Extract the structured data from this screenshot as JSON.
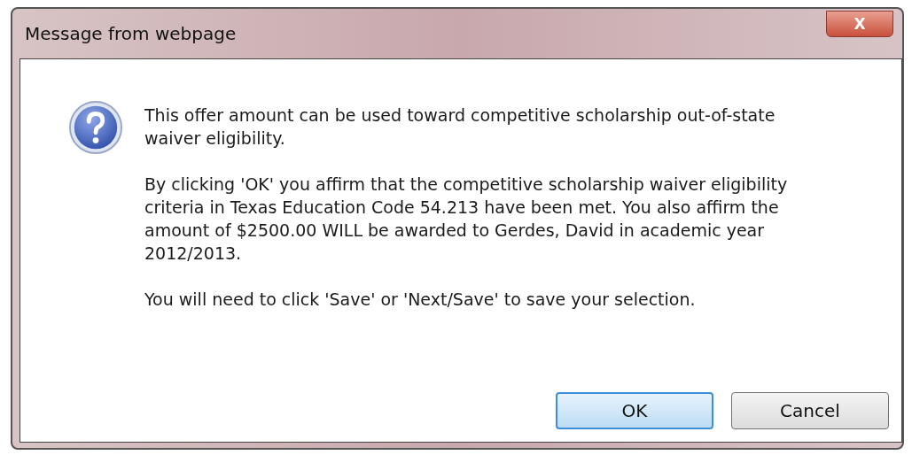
{
  "window": {
    "title": "Message from webpage",
    "close": "X"
  },
  "paragraphs": [
    "This offer amount can be used toward competitive scholarship out-of-state waiver eligibility.",
    "By clicking 'OK' you affirm that the competitive scholarship waiver eligibility criteria in Texas Education Code 54.213 have been met. You also affirm the amount of $2500.00 WILL be awarded to Gerdes, David in academic year 2012/2013.",
    "You will need to click 'Save' or 'Next/Save' to save your selection."
  ],
  "buttons": [
    {
      "label": "OK",
      "default": true
    },
    {
      "label": "Cancel",
      "default": false
    }
  ]
}
